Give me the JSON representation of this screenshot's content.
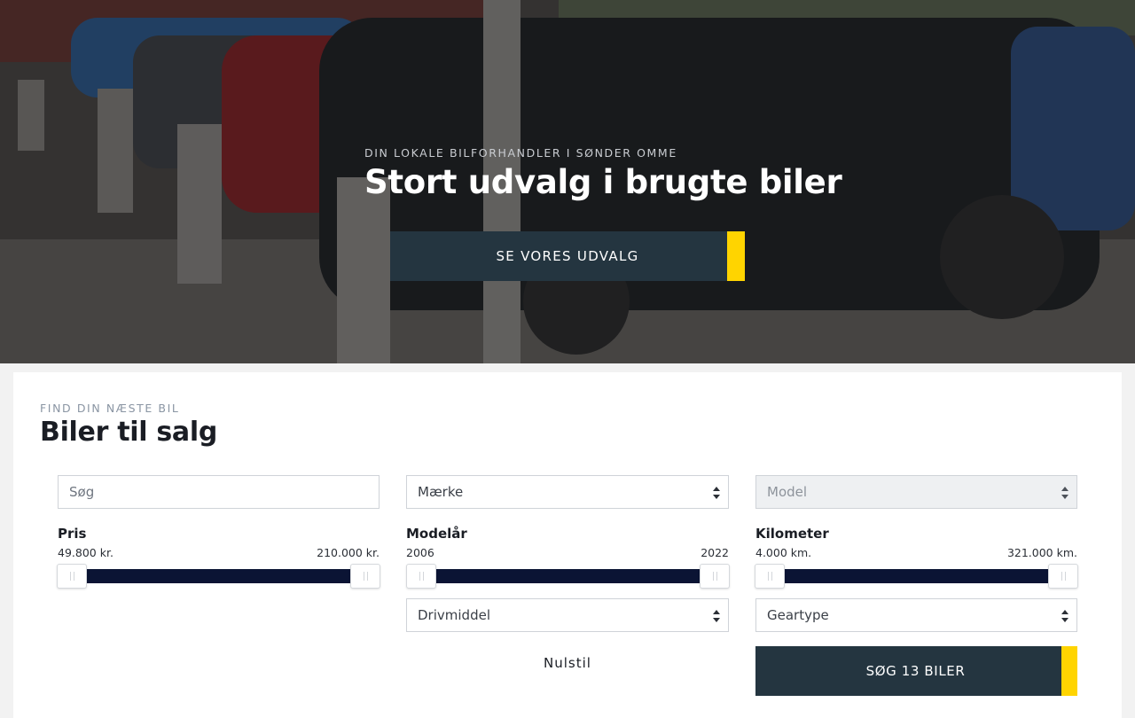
{
  "hero": {
    "eyebrow": "DIN LOKALE BILFORHANDLER I SØNDER OMME",
    "title": "Stort udvalg i brugte biler",
    "cta_label": "SE VORES UDVALG"
  },
  "search": {
    "eyebrow": "FIND DIN NÆSTE BIL",
    "title": "Biler til salg",
    "search_placeholder": "Søg",
    "make_label": "Mærke",
    "model_label": "Model",
    "fuel_label": "Drivmiddel",
    "gear_label": "Geartype",
    "price": {
      "label": "Pris",
      "min": "49.800 kr.",
      "max": "210.000 kr."
    },
    "year": {
      "label": "Modelår",
      "min": "2006",
      "max": "2022"
    },
    "mileage": {
      "label": "Kilometer",
      "min": "4.000 km.",
      "max": "321.000 km."
    },
    "reset_label": "Nulstil",
    "submit_label": "SØG 13 BILER"
  },
  "colors": {
    "accent": "#ffd400",
    "button_dark": "#243540",
    "slider_track": "#0b1434"
  }
}
